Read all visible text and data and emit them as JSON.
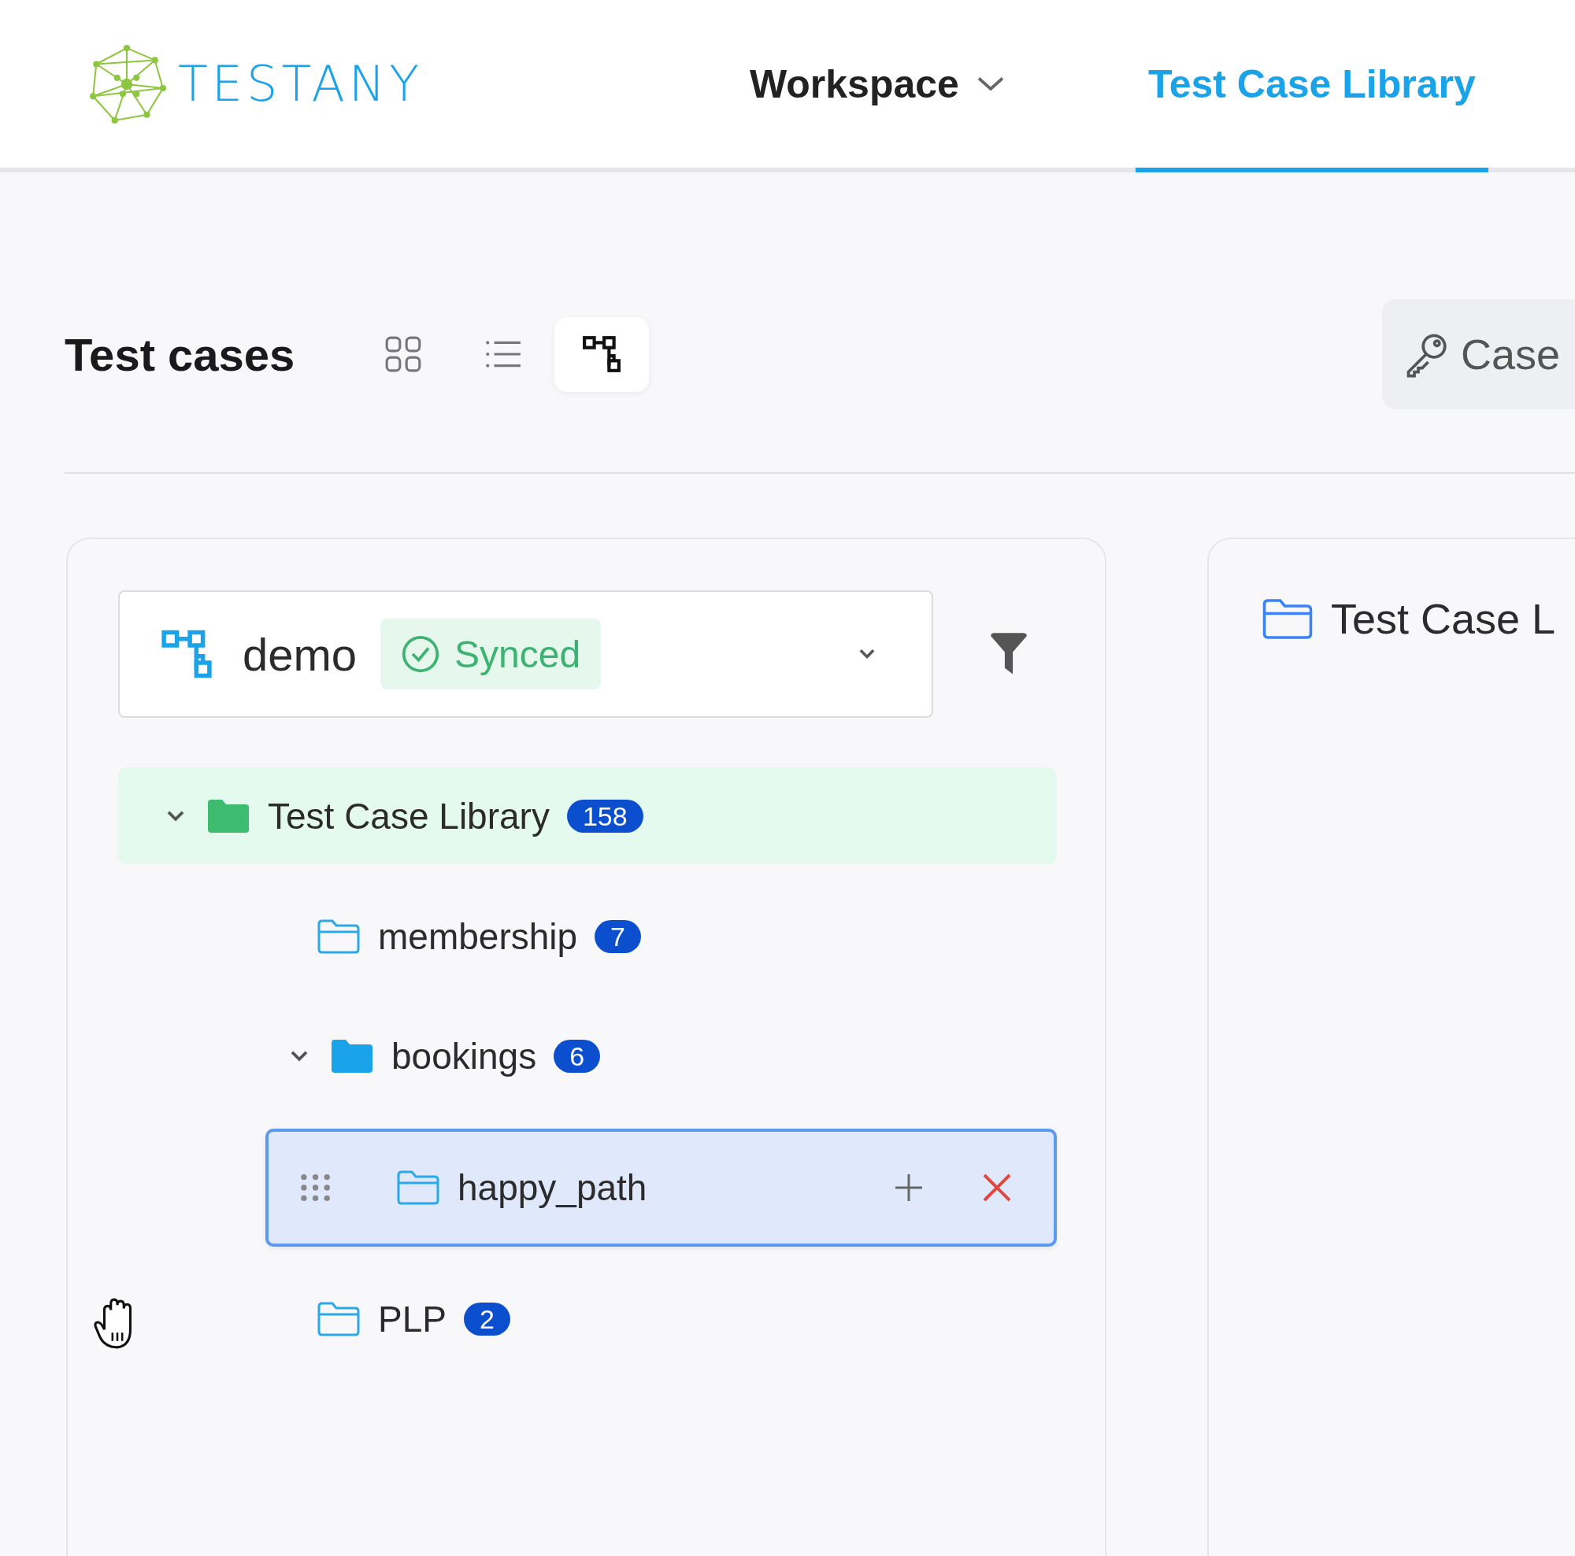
{
  "header": {
    "logo_text": "TESTANY",
    "nav": [
      {
        "label": "Workspace",
        "kind": "dropdown",
        "selected": false
      },
      {
        "label": "Test Case Library",
        "kind": "link",
        "selected": true
      }
    ]
  },
  "toolbar": {
    "title": "Test cases",
    "views": [
      {
        "kind": "grid",
        "selected": false
      },
      {
        "kind": "list",
        "selected": false
      },
      {
        "kind": "tree",
        "selected": true
      }
    ],
    "button": "Case"
  },
  "library": {
    "project": "demo",
    "status": "Synced"
  },
  "tree": [
    {
      "label": "Test Case Library",
      "count": "158",
      "expanded": true,
      "selected": true,
      "focused": false,
      "children": [
        {
          "label": "membership",
          "count": "7",
          "selected": false,
          "focused": false
        },
        {
          "label": "bookings",
          "count": "6",
          "expanded": true,
          "selected": false,
          "focused": false,
          "children": [
            {
              "label": "happy_path",
              "selected": false,
              "focused": true
            }
          ]
        },
        {
          "label": "PLP",
          "count": "2",
          "selected": false,
          "focused": false
        }
      ]
    }
  ],
  "detail": {
    "title": "Test Case L"
  }
}
